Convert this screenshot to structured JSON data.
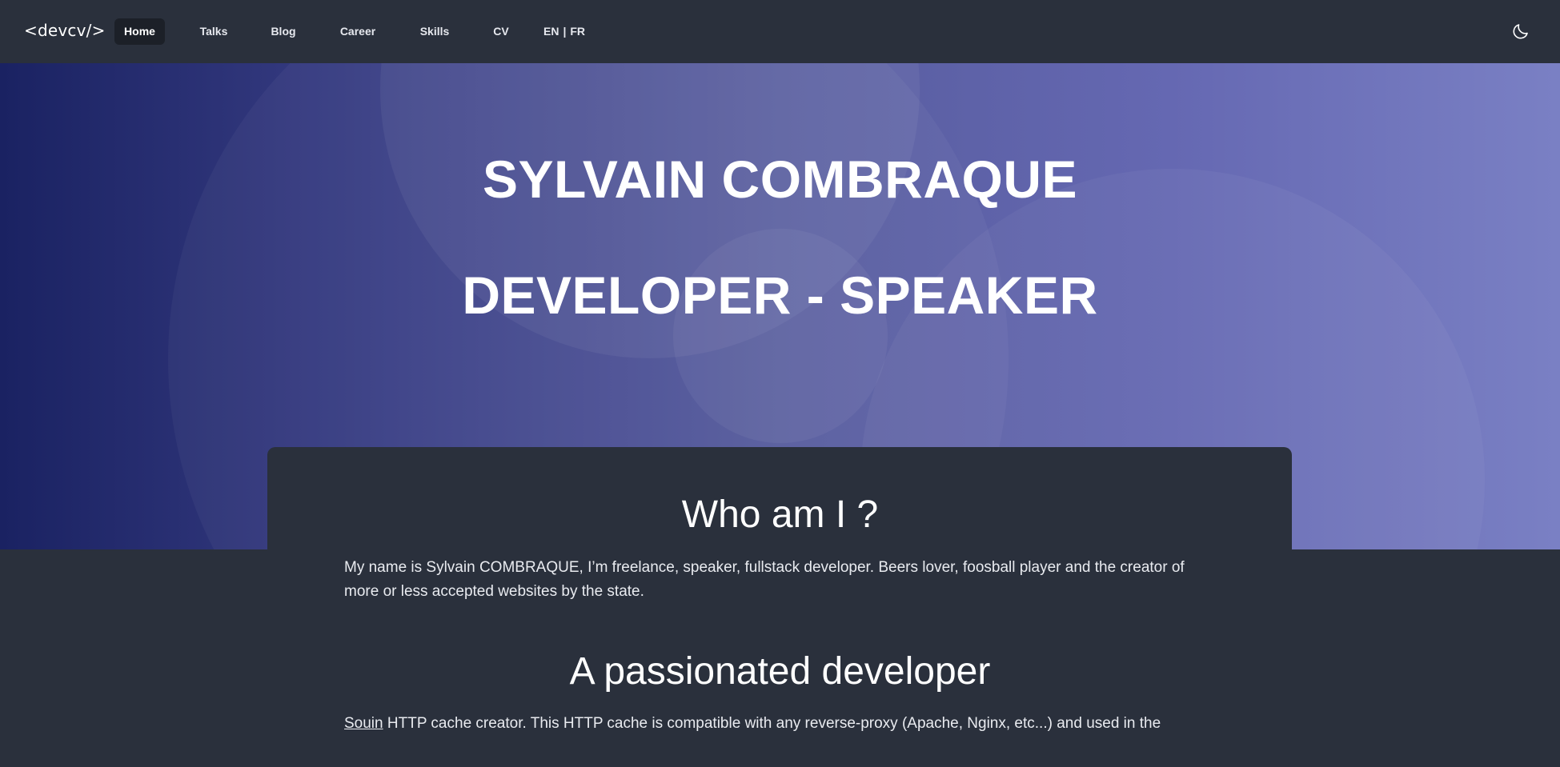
{
  "navbar": {
    "logo": "<devcv/>",
    "items": [
      {
        "label": "Home",
        "active": true
      },
      {
        "label": "Talks",
        "active": false
      },
      {
        "label": "Blog",
        "active": false
      },
      {
        "label": "Career",
        "active": false
      },
      {
        "label": "Skills",
        "active": false
      },
      {
        "label": "CV",
        "active": false
      }
    ],
    "languages": {
      "en": "EN",
      "separator": "|",
      "fr": "FR"
    },
    "theme_toggle_icon": "moon-icon"
  },
  "hero": {
    "name": "SYLVAIN COMBRAQUE",
    "role": "DEVELOPER - SPEAKER",
    "gradient_colors": [
      "#1a2262",
      "#7a80c4"
    ]
  },
  "about": {
    "title": "Who am I ?",
    "text": "My name is Sylvain COMBRAQUE, I’m freelance, speaker, fullstack developer. Beers lover, foosball player and the creator of more or less accepted websites by the state."
  },
  "passion": {
    "title": "A passionated developer",
    "link_label": "Souin",
    "text": " HTTP cache creator. This HTTP cache is compatible with any reverse-proxy (Apache, Nginx, etc...) and used in the"
  },
  "colors": {
    "background": "#2a303c",
    "nav_active": "#1c2028",
    "text": "#ffffff"
  }
}
